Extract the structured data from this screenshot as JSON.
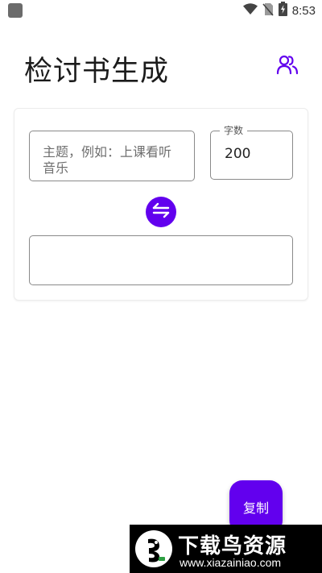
{
  "status_bar": {
    "time": "8:53",
    "icons": [
      "wifi-icon",
      "no-sim-icon",
      "battery-charging-icon"
    ]
  },
  "header": {
    "title": "检讨书生成",
    "users_icon": "users-icon"
  },
  "form": {
    "topic_placeholder": "主题，例如：上课看听音乐",
    "word_count_label": "字数",
    "word_count_value": "200",
    "swap_icon": "swap-arrows-icon",
    "result_text": ""
  },
  "actions": {
    "copy_label": "复制"
  },
  "watermark": {
    "title": "下载鸟资源",
    "url": "www.xiazainiao.com"
  },
  "colors": {
    "accent": "#6200ee",
    "title_text": "#1b1b1b",
    "border": "#8a8a8a"
  }
}
